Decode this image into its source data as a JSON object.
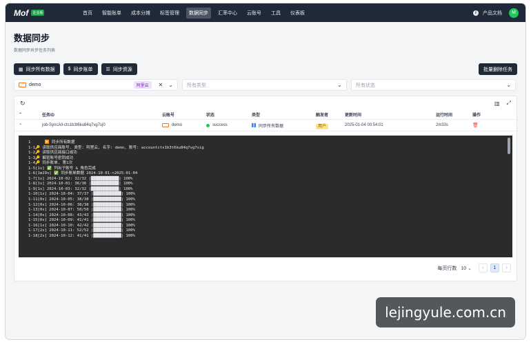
{
  "nav": {
    "logo": "Mof",
    "logo_badge": "企业版",
    "items": [
      "首页",
      "智能账单",
      "成本分摊",
      "标签管理",
      "数据同步",
      "汇率中心",
      "云账号",
      "工具",
      "仪表板"
    ],
    "active_index": 4,
    "docs_label": "产品文档",
    "user_initial": "M"
  },
  "page": {
    "title": "数据同步",
    "subtitle": "数据同步异步任务列表"
  },
  "actions": {
    "sync_all": "同步所有数据",
    "sync_bill": "同步账单",
    "sync_resource": "同步资源",
    "batch_delete": "批量删除任务"
  },
  "filters": {
    "account_value": "demo",
    "account_tag": "阿里云",
    "type_placeholder": "所有类型",
    "status_placeholder": "所有状态"
  },
  "table": {
    "headers": [
      "任务ID",
      "云账号",
      "状态",
      "类型",
      "触发者",
      "更新时间",
      "运行时间",
      "操作"
    ],
    "row": {
      "id": "job-SyncAll-cts1b3t6ku84q7vg7sj0",
      "account": "demo",
      "status": "success",
      "type": "同步所有数据",
      "trigger": "用户",
      "updated": "2025-01-04 00:54:01",
      "duration": "2m33s"
    }
  },
  "log": [
    "1      ▶️ 同步所有数据",
    "1-1🔑 读取供应商账号, 类型: 阿里云, 名字: demo, 账号: accountcts1b3t6ku84q7vg7sig",
    "1-2🔑 读取供应商接口成功",
    "1-3🔑 解密账号密钥成功",
    "1-4🔑 同步账单, 第1次",
    "1-5[1s] ✅ 列出子账号 & 角色完成",
    "1-6[1m29s] ✅ 同步账单数据 2024-10-01->2025-01-04",
    "1-7[1s] 2024-10-02: 32/32 |████████████| 100%",
    "1-8[1s] 2024-10-01: 36/36 |████████████| 100%",
    "1-9[1s] 2024-10-03: 32/32 |████████████| 100%",
    "1-10[1s] 2024-10-04: 37/37 |████████████| 100%",
    "1-11[0s] 2024-10-05: 38/38 |████████████| 100%",
    "1-12[0s] 2024-10-06: 38/38 |████████████| 100%",
    "1-13[0s] 2024-10-07: 50/50 |████████████| 100%",
    "1-14[0s] 2024-10-08: 43/43 |████████████| 100%",
    "1-15[0s] 2024-10-09: 41/41 |████████████| 100%",
    "1-16[1s] 2024-10-10: 42/42 |████████████| 100%",
    "1-17[2s] 2024-10-11: 52/52 |████████████| 100%",
    "1-18[2s] 2024-10-12: 41/41 |████████████| 100%"
  ],
  "pager": {
    "rows_label": "每页行数",
    "rows_value": "10",
    "current_page": "1"
  },
  "watermark": "lejingyule.com.cn"
}
